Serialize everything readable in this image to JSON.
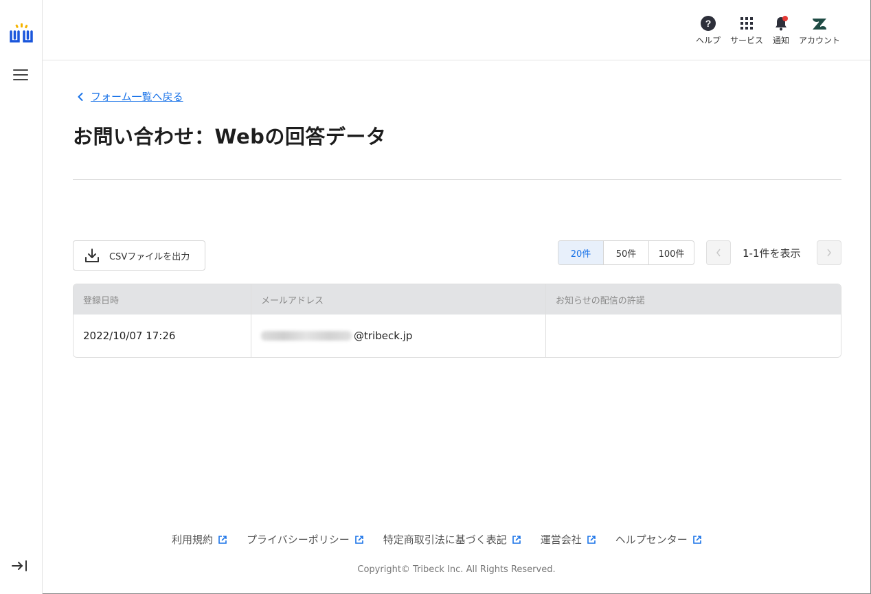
{
  "header": {
    "items": [
      {
        "label": "ヘルプ",
        "icon": "help-icon"
      },
      {
        "label": "サービス",
        "icon": "apps-grid-icon"
      },
      {
        "label": "通知",
        "icon": "bell-icon"
      },
      {
        "label": "アカウント",
        "icon": "zendesk-icon"
      }
    ]
  },
  "main": {
    "back_label": "フォーム一覧へ戻る",
    "title": "お問い合わせ：Webの回答データ",
    "csv_button_label": "CSVファイルを出力",
    "per_page": [
      "20件",
      "50件",
      "100件"
    ],
    "per_page_selected": "20件",
    "pager_label": "1-1件を表示"
  },
  "table": {
    "columns": [
      "登録日時",
      "メールアドレス",
      "お知らせの配信の許諾"
    ],
    "rows": [
      [
        "2022/10/07 17:26",
        "@tribeck.jp",
        ""
      ]
    ]
  },
  "footer": {
    "links": [
      "利用規約",
      "プライバシーポリシー",
      "特定商取引法に基づく表記",
      "運営会社",
      "ヘルプセンター"
    ],
    "copyright": "Copyright© Tribeck Inc. All Rights Reserved."
  },
  "colors": {
    "accent": "#1a73e8",
    "notification_dot": "#e53935",
    "table_header_bg": "#e2e3e5",
    "logo_blue": "#1a56db",
    "logo_yellow": "#f5b400"
  }
}
